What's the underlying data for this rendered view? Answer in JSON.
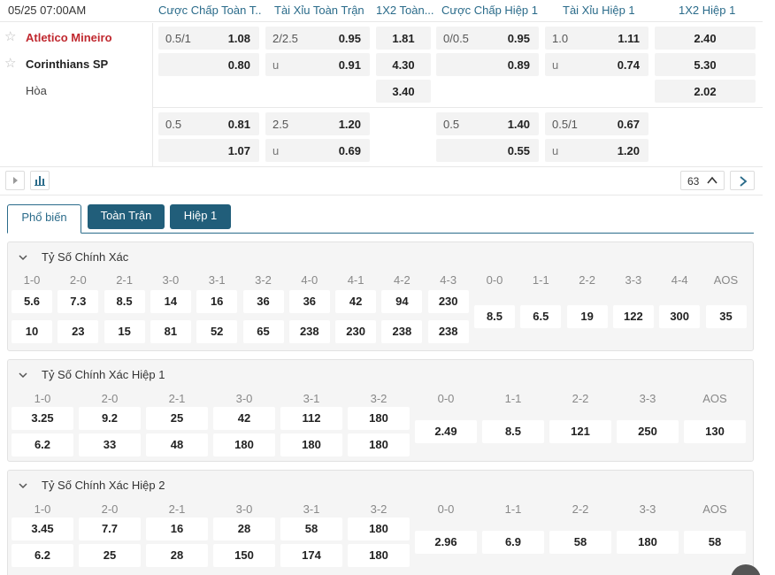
{
  "header": {
    "time": "05/25 07:00AM",
    "cols": [
      "Cược Chấp Toàn T...",
      "Tài Xỉu Toàn Trận",
      "1X2 Toàn...",
      "Cược Chấp Hiệp 1",
      "Tài Xỉu Hiệp 1",
      "1X2 Hiệp 1"
    ]
  },
  "teams": {
    "home": "Atletico Mineiro",
    "away": "Corinthians SP",
    "draw": "Hòa"
  },
  "odds": {
    "row1": {
      "hdp_line": "0.5/1",
      "hdp_home": "1.08",
      "hdp_away": "0.80",
      "ou_line": "2/2.5",
      "ou_over": "0.95",
      "ou_u": "u",
      "ou_under": "0.91",
      "x12_home": "1.81",
      "x12_away": "4.30",
      "x12_draw": "3.40",
      "h1_hdp_line": "0/0.5",
      "h1_hdp_home": "0.95",
      "h1_hdp_away": "0.89",
      "h1_ou_line": "1.0",
      "h1_ou_over": "1.11",
      "h1_ou_u": "u",
      "h1_ou_under": "0.74",
      "h1_x12_home": "2.40",
      "h1_x12_away": "5.30",
      "h1_x12_draw": "2.02"
    },
    "row2": {
      "hdp_line": "0.5",
      "hdp_home": "0.81",
      "hdp_away": "1.07",
      "ou_line": "2.5",
      "ou_over": "1.20",
      "ou_u": "u",
      "ou_under": "0.69",
      "h1_hdp_line": "0.5",
      "h1_hdp_home": "1.40",
      "h1_hdp_away": "0.55",
      "h1_ou_line": "0.5/1",
      "h1_ou_over": "0.67",
      "h1_ou_u": "u",
      "h1_ou_under": "1.20"
    }
  },
  "controls": {
    "more_count": "63"
  },
  "tabs": {
    "popular": "Phổ biến",
    "full": "Toàn Trận",
    "half1": "Hiệp 1"
  },
  "sections": {
    "cs": {
      "title": "Tỷ Số Chính Xác",
      "labels": [
        "1-0",
        "2-0",
        "2-1",
        "3-0",
        "3-1",
        "3-2",
        "4-0",
        "4-1",
        "4-2",
        "4-3",
        "0-0",
        "1-1",
        "2-2",
        "3-3",
        "4-4",
        "AOS"
      ],
      "top": [
        "5.6",
        "7.3",
        "8.5",
        "14",
        "16",
        "36",
        "36",
        "42",
        "94",
        "230"
      ],
      "bottom": [
        "10",
        "23",
        "15",
        "81",
        "52",
        "65",
        "238",
        "230",
        "238",
        "238"
      ],
      "mid": [
        "8.5",
        "6.5",
        "19",
        "122",
        "300",
        "35"
      ]
    },
    "cs_h1": {
      "title": "Tỷ Số Chính Xác Hiệp 1",
      "labels": [
        "1-0",
        "2-0",
        "2-1",
        "3-0",
        "3-1",
        "3-2",
        "0-0",
        "1-1",
        "2-2",
        "3-3",
        "AOS"
      ],
      "top": [
        "3.25",
        "9.2",
        "25",
        "42",
        "112",
        "180"
      ],
      "bottom": [
        "6.2",
        "33",
        "48",
        "180",
        "180",
        "180"
      ],
      "mid": [
        "2.49",
        "8.5",
        "121",
        "250",
        "130"
      ]
    },
    "cs_h2": {
      "title": "Tỷ Số Chính Xác Hiệp 2",
      "labels": [
        "1-0",
        "2-0",
        "2-1",
        "3-0",
        "3-1",
        "3-2",
        "0-0",
        "1-1",
        "2-2",
        "3-3",
        "AOS"
      ],
      "top": [
        "3.45",
        "7.7",
        "16",
        "28",
        "58",
        "180"
      ],
      "bottom": [
        "6.2",
        "25",
        "28",
        "150",
        "174",
        "180"
      ],
      "mid": [
        "2.96",
        "6.9",
        "58",
        "180",
        "58"
      ]
    }
  }
}
